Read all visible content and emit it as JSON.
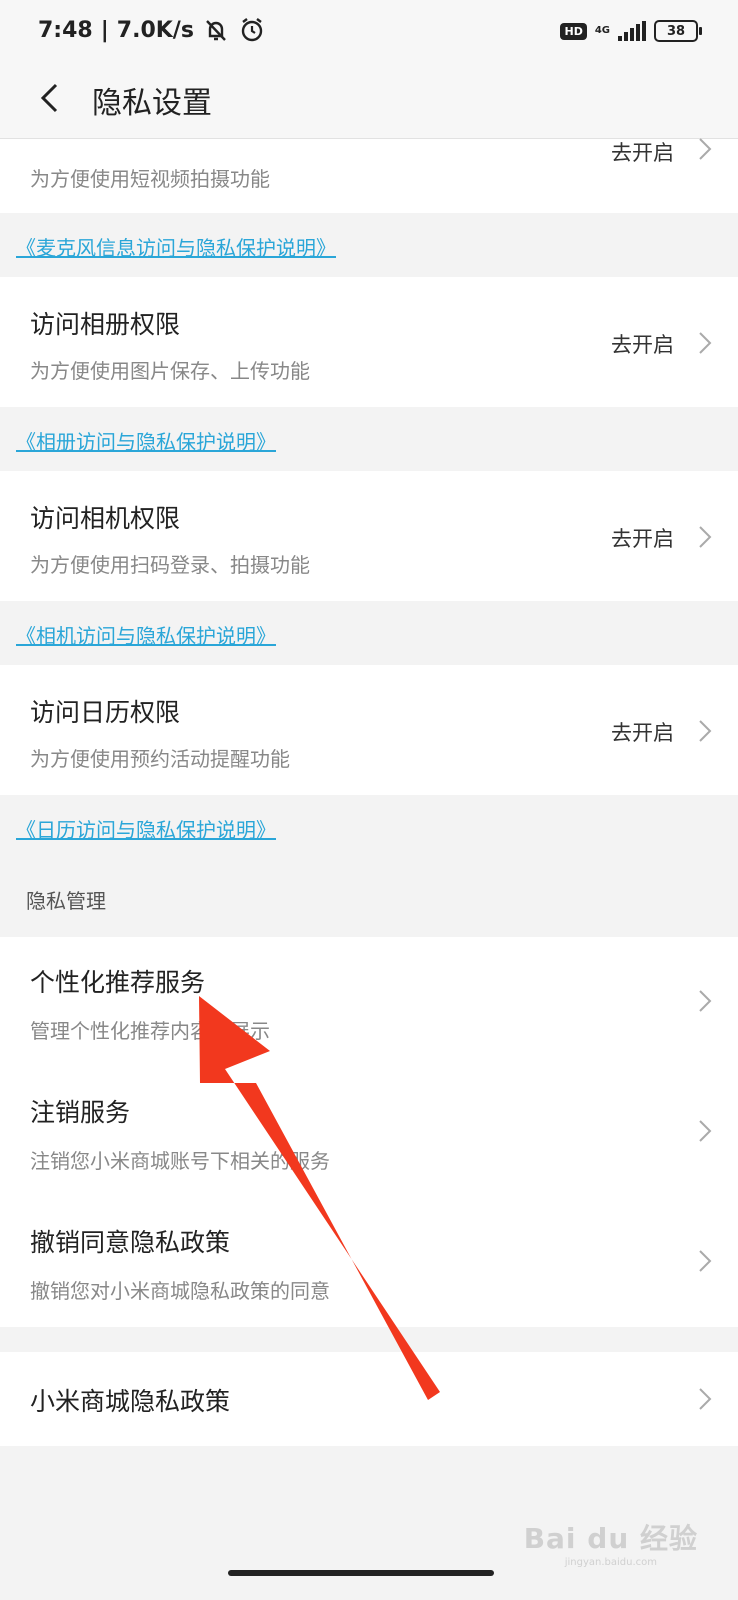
{
  "status": {
    "time": "7:48",
    "speed": "7.0K/s",
    "hd": "HD",
    "network": "4G",
    "battery": "38"
  },
  "header": {
    "title": "隐私设置"
  },
  "permissions": [
    {
      "title": "",
      "subtitle": "为方便使用短视频拍摄功能",
      "action": "去开启",
      "link": "《麦克风信息访问与隐私保护说明》"
    },
    {
      "title": "访问相册权限",
      "subtitle": "为方便使用图片保存、上传功能",
      "action": "去开启",
      "link": "《相册访问与隐私保护说明》"
    },
    {
      "title": "访问相机权限",
      "subtitle": "为方便使用扫码登录、拍摄功能",
      "action": "去开启",
      "link": "《相机访问与隐私保护说明》"
    },
    {
      "title": "访问日历权限",
      "subtitle": "为方便使用预约活动提醒功能",
      "action": "去开启",
      "link": "《日历访问与隐私保护说明》"
    }
  ],
  "privacy_section": {
    "header": "隐私管理",
    "items": [
      {
        "title": "个性化推荐服务",
        "subtitle": "管理个性化推荐内容的展示"
      },
      {
        "title": "注销服务",
        "subtitle": "注销您小米商城账号下相关的服务"
      },
      {
        "title": "撤销同意隐私政策",
        "subtitle": "撤销您对小米商城隐私政策的同意"
      }
    ]
  },
  "policy": {
    "title": "小米商城隐私政策"
  },
  "watermark": {
    "brand": "Bai du 经验",
    "url": "jingyan.baidu.com"
  },
  "colors": {
    "link": "#2aa6d8",
    "arrow": "#f2381e"
  }
}
